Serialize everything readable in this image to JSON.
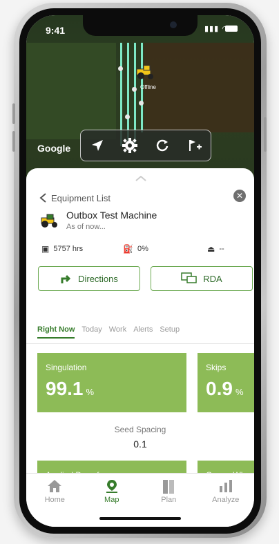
{
  "status_bar": {
    "time": "9:41"
  },
  "map": {
    "attribution": "Google",
    "marker_label": "Offline"
  },
  "equipment": {
    "back_label": "Equipment List",
    "name": "Outbox Test Machine",
    "subtitle": "As of now...",
    "hours": "5757 hrs",
    "fuel": "0%",
    "other_stat": "--"
  },
  "actions": {
    "directions": "Directions",
    "rda": "RDA"
  },
  "tabs": [
    "Right Now",
    "Today",
    "Work",
    "Alerts",
    "Setup"
  ],
  "metrics": {
    "singulation": {
      "label": "Singulation",
      "value": "99.1",
      "unit": "%"
    },
    "skips": {
      "label": "Skips",
      "value": "0.9",
      "unit": "%"
    },
    "seed_spacing": {
      "label": "Seed Spacing",
      "value": "0.1"
    },
    "applied_downforce": {
      "label": "Applied Downforce"
    },
    "gauge_wheel": {
      "label": "Gauge Whee"
    }
  },
  "nav": [
    "Home",
    "Map",
    "Plan",
    "Analyze"
  ],
  "colors": {
    "accent": "#367c2b",
    "card": "#8dbb57"
  }
}
